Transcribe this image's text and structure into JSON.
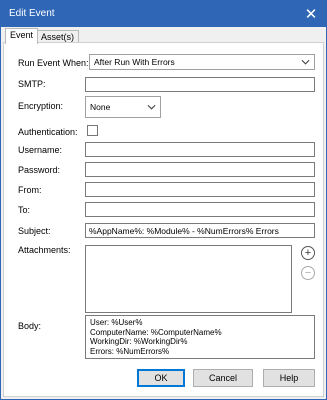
{
  "window": {
    "title": "Edit Event",
    "close_glyph": "✕"
  },
  "tabs": [
    {
      "label": "Event",
      "active": true
    },
    {
      "label": "Asset(s)",
      "active": false
    }
  ],
  "form": {
    "run_event_when": {
      "label": "Run Event When:",
      "value": "After Run With Errors"
    },
    "smtp": {
      "label": "SMTP:",
      "value": ""
    },
    "encryption": {
      "label": "Encryption:",
      "value": "None"
    },
    "authentication": {
      "label": "Authentication:",
      "checked": false
    },
    "username": {
      "label": "Username:",
      "value": ""
    },
    "password": {
      "label": "Password:",
      "value": ""
    },
    "from": {
      "label": "From:",
      "value": ""
    },
    "to": {
      "label": "To:",
      "value": ""
    },
    "subject": {
      "label": "Subject:",
      "value": "%AppName%: %Module% - %NumErrors% Errors"
    },
    "attachments": {
      "label": "Attachments:",
      "add_icon": "plus-circle-icon",
      "remove_icon": "minus-circle-icon"
    },
    "body": {
      "label": "Body:",
      "lines": [
        "User: %User%",
        "ComputerName: %ComputerName%",
        "WorkingDir: %WorkingDir%",
        "Errors: %NumErrors%"
      ]
    }
  },
  "buttons": {
    "ok": "OK",
    "cancel": "Cancel",
    "help": "Help"
  },
  "colors": {
    "titlebar": "#2f66b6",
    "accent": "#0078d7"
  }
}
